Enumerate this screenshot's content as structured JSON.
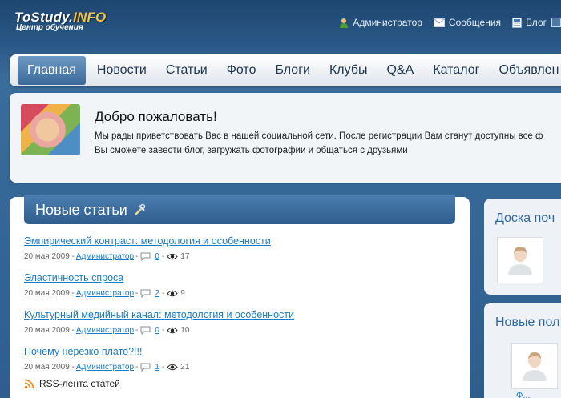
{
  "logo": {
    "title_main": "ToStudy.",
    "title_accent": "INFO",
    "subtitle": "Центр обучения"
  },
  "toplinks": [
    {
      "label": "Администратор",
      "icon": "user-icon"
    },
    {
      "label": "Сообщения",
      "icon": "mail-icon"
    },
    {
      "label": "Блог",
      "icon": "blog-icon"
    }
  ],
  "nav": {
    "items": [
      "Главная",
      "Новости",
      "Статьи",
      "Фото",
      "Блоги",
      "Клубы",
      "Q&A",
      "Каталог",
      "Объявлен"
    ],
    "active": "Главная"
  },
  "welcome": {
    "title": "Добро пожаловать!",
    "line1": "Мы рады приветствовать Вас в нашей социальной сети. После регистрации Вам станут доступны все ф",
    "line2": "Вы сможете завести блог, загружать фотографии и общаться с друзьями"
  },
  "articles": {
    "title": "Новые статьи",
    "items": [
      {
        "title": "Эмпирический контраст: методология и особенности",
        "date": "20 мая 2009",
        "author": "Администратор",
        "comments": "0",
        "views": "17"
      },
      {
        "title": "Эластичность спроса",
        "date": "20 мая 2009",
        "author": "Администратор",
        "comments": "2",
        "views": "9"
      },
      {
        "title": "Культурный медийный канал: методология и особенности",
        "date": "20 мая 2009",
        "author": "Администратор",
        "comments": "0",
        "views": "10"
      },
      {
        "title": "Почему нерезко плато?!!!",
        "date": "20 мая 2009",
        "author": "Администратор",
        "comments": "1",
        "views": "21"
      }
    ],
    "rss": "RSS-лента статей"
  },
  "side": {
    "board_title": "Доска поч",
    "new_users_title": "Новые пол",
    "new_user_name": "Ф..."
  },
  "colors": {
    "link": "#1a7bc4",
    "nav_active": "#3c6a98",
    "accent": "#f6c343"
  }
}
